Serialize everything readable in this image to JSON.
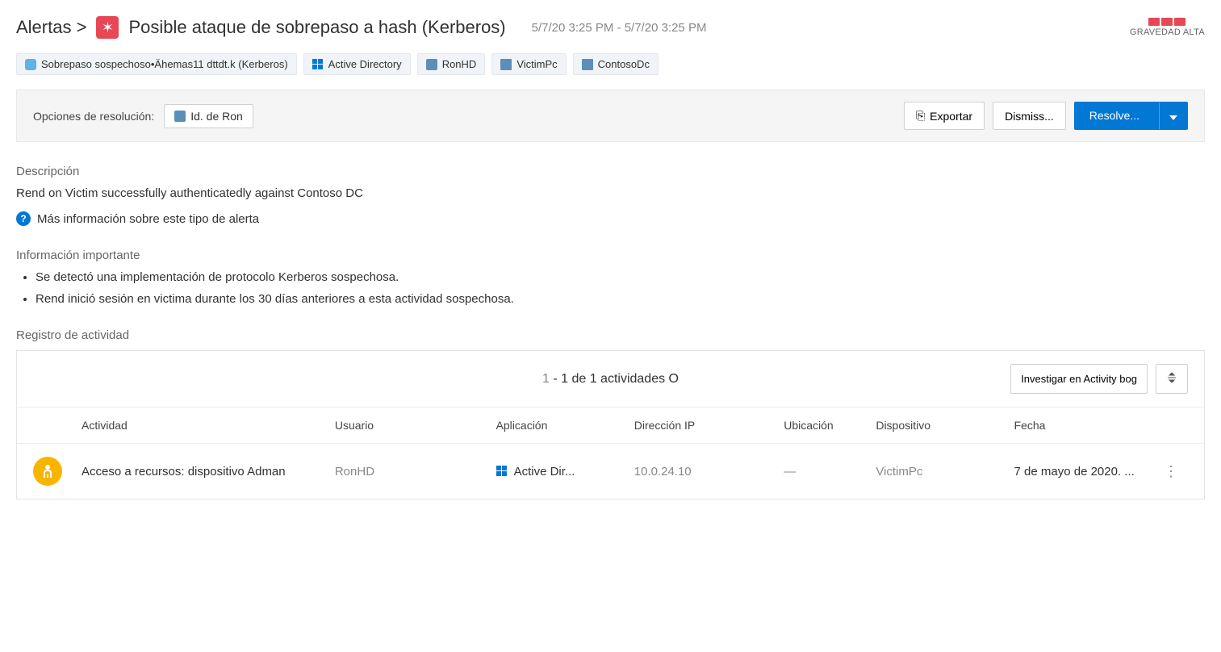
{
  "header": {
    "breadcrumb": "Alertas >",
    "title": "Posible ataque de sobrepaso a hash (Kerberos)",
    "timestamp": "5/7/20 3:25 PM - 5/7/20 3:25 PM",
    "severity_label": "GRAVEDAD ALTA"
  },
  "tags": [
    {
      "icon": "cloud",
      "label": "Sobrepaso sospechoso•Ähemas11 dttdt.k (Kerberos)"
    },
    {
      "icon": "win",
      "label": "Active Directory"
    },
    {
      "icon": "user",
      "label": "RonHD"
    },
    {
      "icon": "pc",
      "label": "VictimPc"
    },
    {
      "icon": "pc",
      "label": "ContosoDc"
    }
  ],
  "toolbar": {
    "label": "Opciones de resolución:",
    "id_btn": "Id. de Ron",
    "export": "Exportar",
    "dismiss": "Dismiss...",
    "resolve": "Resolve..."
  },
  "description": {
    "heading": "Descripción",
    "text": "Rend on Victim successfully authenticatedly against Contoso DC",
    "info_link": "Más información sobre este tipo de alerta"
  },
  "important": {
    "heading": "Información importante",
    "items": [
      "Se detectó una implementación de protocolo Kerberos sospechosa.",
      "Rend inició sesión en victima durante los 30 días anteriores a esta actividad sospechosa."
    ]
  },
  "activity": {
    "heading": "Registro de actividad",
    "count_prefix": "1",
    "count_text": " - 1 de 1 actividades O",
    "investigate_btn": "Investigar en Activity bog",
    "columns": {
      "activity": "Actividad",
      "user": "Usuario",
      "app": "Aplicación",
      "ip": "Dirección IP",
      "location": "Ubicación",
      "device": "Dispositivo",
      "date": "Fecha"
    },
    "rows": [
      {
        "activity": "Acceso a recursos: dispositivo Adman",
        "user": "RonHD",
        "app": "Active Dir...",
        "ip": "10.0.24.10",
        "location": "—",
        "device": "VictimPc",
        "date": "7 de mayo de 2020. ..."
      }
    ]
  }
}
